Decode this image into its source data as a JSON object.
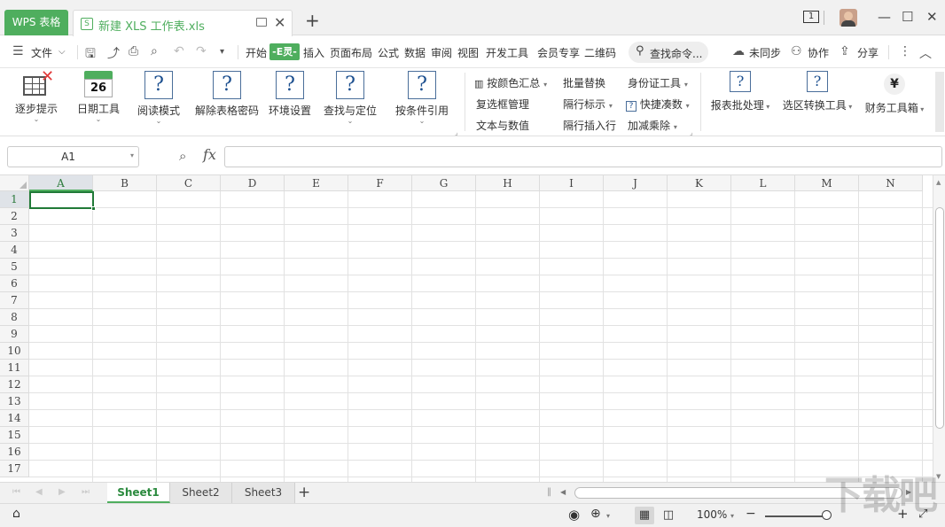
{
  "titlebar": {
    "app_tab": "WPS 表格",
    "doc_tab": "新建 XLS 工作表.xls",
    "doc_icon": "S",
    "new_tab": "+",
    "window_count": "1"
  },
  "menubar": {
    "file": "文件",
    "items": [
      "开始",
      "插入",
      "页面布局",
      "公式",
      "数据",
      "审阅",
      "视图",
      "开发工具",
      "会员专享",
      "二维码"
    ],
    "e_tab": "-E灵-",
    "search_placeholder": "查找命令...",
    "sync": "未同步",
    "collab": "协作",
    "share": "分享"
  },
  "ribbon": {
    "big_tools": [
      "逐步提示",
      "日期工具",
      "阅读模式",
      "解除表格密码",
      "环境设置",
      "查找与定位",
      "按条件引用"
    ],
    "calendar_number": "26",
    "small_tools": {
      "col1": [
        "按颜色汇总",
        "复选框管理",
        "文本与数值"
      ],
      "col2": [
        "批量替换",
        "隔行标示",
        "隔行插入行"
      ],
      "col3": [
        "身份证工具",
        "快捷凑数",
        "加减乘除"
      ]
    },
    "right_tools": [
      "报表批处理",
      "选区转换工具",
      "财务工具箱"
    ],
    "yen_symbol": "¥"
  },
  "formulabar": {
    "name_box": "A1",
    "fx_label": "fx",
    "formula_value": ""
  },
  "grid": {
    "columns": [
      "A",
      "B",
      "C",
      "D",
      "E",
      "F",
      "G",
      "H",
      "I",
      "J",
      "K",
      "L",
      "M",
      "N"
    ],
    "rows": [
      "1",
      "2",
      "3",
      "4",
      "5",
      "6",
      "7",
      "8",
      "9",
      "10",
      "11",
      "12",
      "13",
      "14",
      "15",
      "16",
      "17"
    ],
    "active_cell": "A1"
  },
  "sheets": {
    "tabs": [
      "Sheet1",
      "Sheet2",
      "Sheet3"
    ],
    "active": "Sheet1",
    "add": "+"
  },
  "statusbar": {
    "zoom": "100%",
    "zoom_minus": "−",
    "zoom_plus": "+"
  },
  "colors": {
    "accent": "#4fae5e",
    "active_cell_border": "#217a38"
  },
  "watermark": "下载吧"
}
